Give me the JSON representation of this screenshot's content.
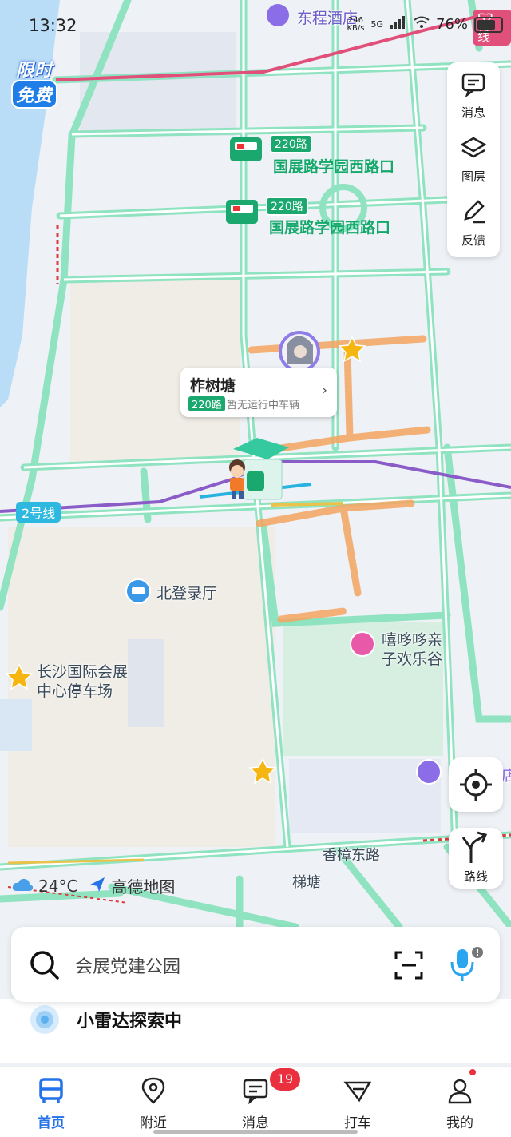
{
  "status_bar": {
    "time": "13:32",
    "network_speed": "246",
    "network_unit": "KB/s",
    "network_type": "5G",
    "battery": "76%"
  },
  "promo": {
    "line1": "限时",
    "line2": "免费"
  },
  "map_controls": {
    "messages_label": "消息",
    "layers_label": "图层",
    "feedback_label": "反馈",
    "route_label": "路线"
  },
  "map": {
    "top_poi": "东程酒店",
    "metro_s2": "S2线",
    "metro_2": "2号线",
    "stop_1": {
      "route": "220路",
      "name": "国展路学园西路口"
    },
    "stop_2": {
      "route": "220路",
      "name": "国展路学园西路口"
    },
    "callout": {
      "name": "柞树塘",
      "route": "220路",
      "status": "暂无运行中车辆"
    },
    "poi_hall": "北登录厅",
    "poi_kids_line1": "嘻哆哆亲",
    "poi_kids_line2": "子欢乐谷",
    "poi_parking_line1": "长沙国际会展",
    "poi_parking_line2": "中心停车场",
    "road_xiangzhang": "香樟东路",
    "place_meitang": "梯塘",
    "hotel_edge": "店"
  },
  "weather": {
    "temp": "24°C",
    "brand": "高德地图"
  },
  "search": {
    "placeholder": "会展党建公园"
  },
  "radar": {
    "text": "小雷达探索中"
  },
  "bottom_nav": {
    "home": "首页",
    "nearby": "附近",
    "messages": "消息",
    "messages_badge": "19",
    "taxi": "打车",
    "mine": "我的"
  },
  "colors": {
    "road": "#8fe3c0",
    "metro_s2": "#e0507a",
    "metro_2": "#8a5cc8",
    "accent": "#2573e8",
    "bus_green": "#1aa86e",
    "footprint": "#f4a560"
  }
}
